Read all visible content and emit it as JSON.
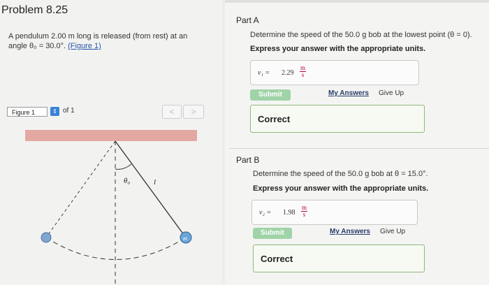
{
  "problem": {
    "title": "Problem 8.25",
    "text_line1": "A pendulum 2.00 m long is released (from rest) at an",
    "text_line2_prefix": "angle θ₀ = 30.0°.",
    "figure_link": "(Figure 1)"
  },
  "figure": {
    "label": "Figure 1",
    "of": "of 1",
    "prev_glyph": "<",
    "next_glyph": ">",
    "angle_label": "θ₀",
    "length_label": "l",
    "bob_label": "m"
  },
  "partA": {
    "title": "Part A",
    "question": "Determine the speed of the 50.0 g bob at the lowest point (θ = 0).",
    "instruction": "Express your answer with the appropriate units.",
    "var": "v₁ =",
    "value": "2.29",
    "unit_num": "m",
    "unit_den": "s",
    "submit": "Submit",
    "my_answers": "My Answers",
    "give_up": "Give Up",
    "result": "Correct"
  },
  "partB": {
    "title": "Part B",
    "question": "Determine the speed of the 50.0 g bob at θ = 15.0°.",
    "instruction": "Express your answer with the appropriate units.",
    "var": "v₂ =",
    "value": "1.98",
    "unit_num": "m",
    "unit_den": "s",
    "submit": "Submit",
    "my_answers": "My Answers",
    "give_up": "Give Up",
    "result": "Correct"
  }
}
